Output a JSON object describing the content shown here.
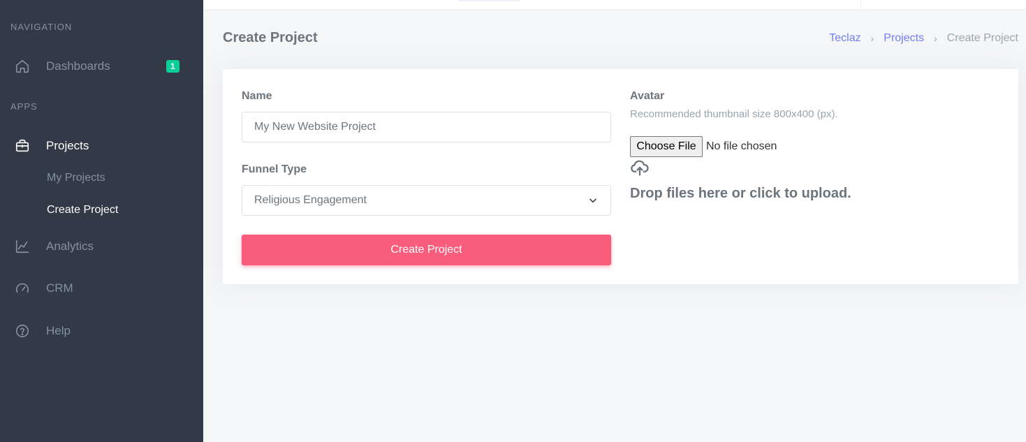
{
  "sidebar": {
    "navigation_title": "NAVIGATION",
    "apps_title": "APPS",
    "dashboards": {
      "label": "Dashboards",
      "badge": "1",
      "icon": "home-icon"
    },
    "projects": {
      "label": "Projects",
      "icon": "briefcase-icon"
    },
    "sub_items": [
      {
        "label": "My Projects"
      },
      {
        "label": "Create Project"
      }
    ],
    "analytics": {
      "label": "Analytics",
      "icon": "line-chart-icon"
    },
    "crm": {
      "label": "CRM",
      "icon": "gauge-icon"
    },
    "help": {
      "label": "Help",
      "icon": "help-circle-icon"
    }
  },
  "page": {
    "title": "Create Project",
    "breadcrumb": [
      {
        "label": "Teclaz"
      },
      {
        "label": "Projects"
      },
      {
        "label": "Create Project"
      }
    ]
  },
  "form": {
    "name_label": "Name",
    "name_value": "My New Website Project",
    "funnel_label": "Funnel Type",
    "funnel_value": "Religious Engagement",
    "submit_label": "Create Project",
    "avatar_label": "Avatar",
    "avatar_hint": "Recommended thumbnail size 800x400 (px).",
    "file_button": "Choose File",
    "file_status": "No file chosen",
    "drop_text": "Drop files here or click to upload."
  },
  "colors": {
    "sidebar_bg": "#313a46",
    "accent": "#727cf5",
    "danger": "#fa5c7c",
    "success": "#0acf97"
  }
}
